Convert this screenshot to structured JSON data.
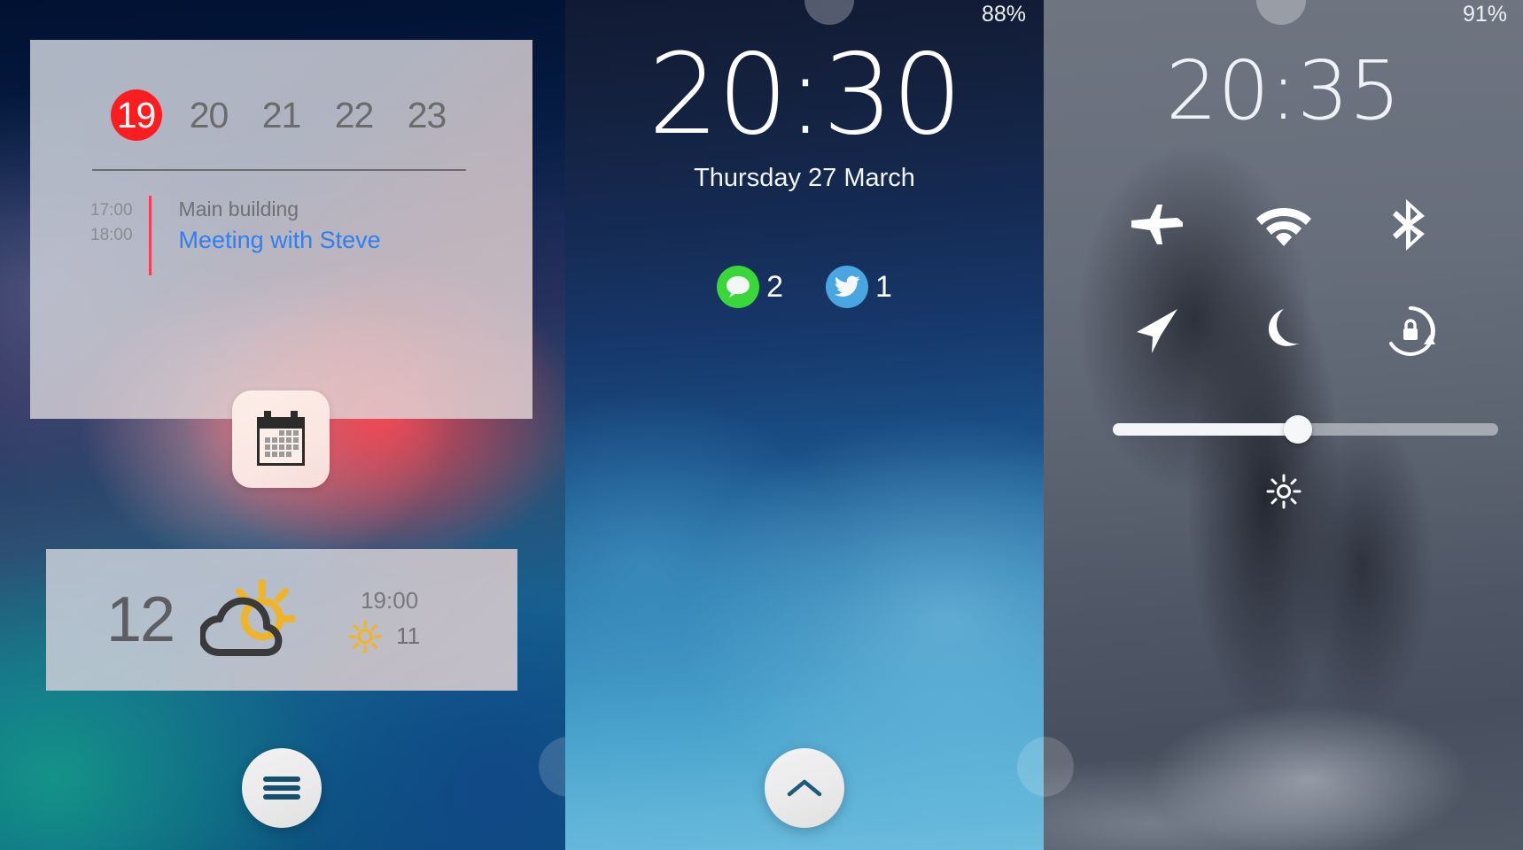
{
  "panel1": {
    "name": "widget-lock-screen",
    "calendar_widget": {
      "days": [
        {
          "label": "19",
          "selected": true
        },
        {
          "label": "20",
          "selected": false
        },
        {
          "label": "21",
          "selected": false
        },
        {
          "label": "22",
          "selected": false
        },
        {
          "label": "23",
          "selected": false
        }
      ],
      "selected_day_color": "#fc1d21",
      "event": {
        "start_time": "17:00",
        "end_time": "18:00",
        "location": "Main building",
        "title": "Meeting with Steve",
        "title_color": "#2f7ff0",
        "accent_bar_color": "#fc3d55"
      },
      "app_icon_name": "calendar-icon"
    },
    "weather_widget": {
      "current_temp": "12",
      "condition_icon_name": "partly-cloudy-icon",
      "forecast_time": "19:00",
      "forecast_icon_name": "sun-icon",
      "forecast_temp": "11",
      "sun_color": "#f0b429"
    },
    "fab_icon_name": "hamburger-menu-icon"
  },
  "panel2": {
    "name": "lock-screen-clock",
    "battery": "88%",
    "clock": "20:30",
    "date": "Thursday 27 March",
    "notifications": [
      {
        "app": "messages",
        "icon_name": "messages-bubble-icon",
        "count": "2",
        "color": "#3ad73a"
      },
      {
        "app": "twitter",
        "icon_name": "twitter-bird-icon",
        "count": "1",
        "color": "#4aa6e0"
      }
    ],
    "fab_icon_name": "chevron-up-icon"
  },
  "panel3": {
    "name": "control-center",
    "battery": "91%",
    "clock": "20:35",
    "toggles": [
      {
        "icon_name": "airplane-mode-icon",
        "label": "Airplane Mode"
      },
      {
        "icon_name": "wifi-icon",
        "label": "Wi-Fi"
      },
      {
        "icon_name": "bluetooth-icon",
        "label": "Bluetooth"
      },
      {
        "icon_name": "location-arrow-icon",
        "label": "Location"
      },
      {
        "icon_name": "do-not-disturb-moon-icon",
        "label": "Do Not Disturb"
      },
      {
        "icon_name": "rotation-lock-icon",
        "label": "Rotation Lock"
      }
    ],
    "brightness_slider": {
      "value_percent": 48,
      "icon_name": "brightness-sun-icon"
    }
  }
}
